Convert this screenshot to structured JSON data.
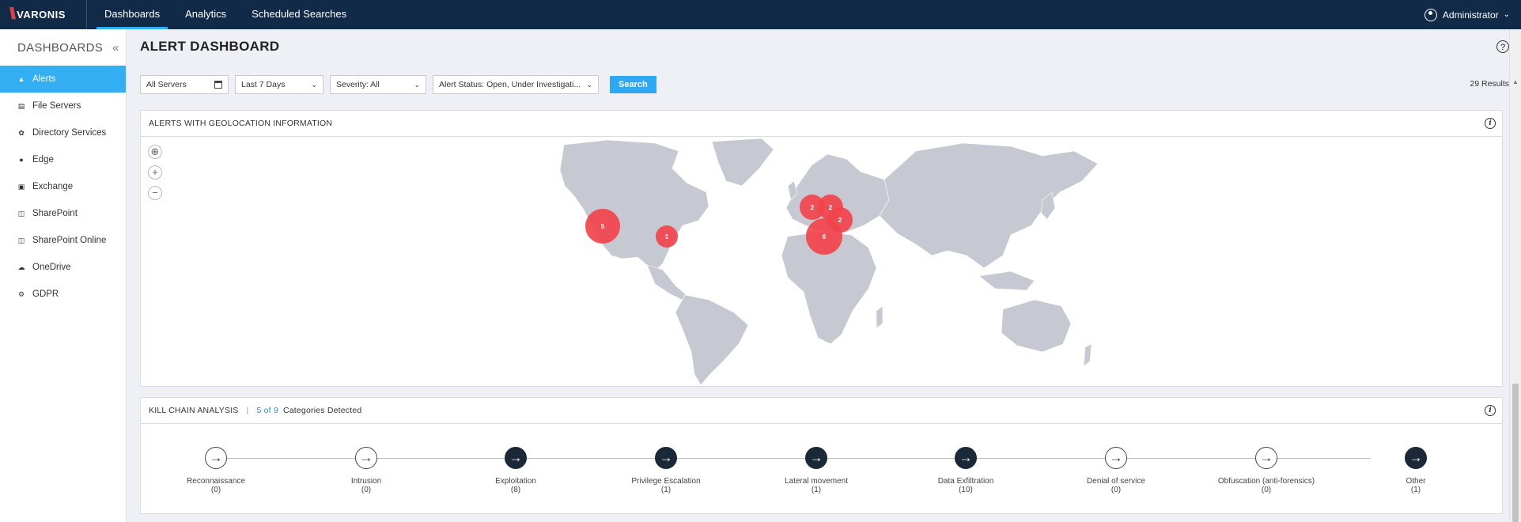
{
  "brand": {
    "name": "VARONIS"
  },
  "nav": {
    "items": [
      "Dashboards",
      "Analytics",
      "Scheduled Searches"
    ],
    "active": "Dashboards"
  },
  "user": {
    "name": "Administrator"
  },
  "sidebar": {
    "title": "DASHBOARDS",
    "items": [
      {
        "label": "Alerts",
        "icon": "bell-icon",
        "active": true
      },
      {
        "label": "File Servers",
        "icon": "database-icon",
        "active": false
      },
      {
        "label": "Directory Services",
        "icon": "network-icon",
        "active": false
      },
      {
        "label": "Edge",
        "icon": "shield-icon",
        "active": false
      },
      {
        "label": "Exchange",
        "icon": "exchange-icon",
        "active": false
      },
      {
        "label": "SharePoint",
        "icon": "sharepoint-icon",
        "active": false
      },
      {
        "label": "SharePoint Online",
        "icon": "sharepoint-online-icon",
        "active": false
      },
      {
        "label": "OneDrive",
        "icon": "cloud-icon",
        "active": false
      },
      {
        "label": "GDPR",
        "icon": "gear-icon",
        "active": false
      }
    ]
  },
  "page": {
    "title": "ALERT DASHBOARD"
  },
  "filters": {
    "servers": "All Servers",
    "date_range": "Last 7 Days",
    "severity": "Severity:  All",
    "alert_status": "Alert Status:  Open, Under Investigati...",
    "search_label": "Search",
    "results": "29 Results"
  },
  "map_panel": {
    "title": "ALERTS WITH GEOLOCATION INFORMATION",
    "markers": [
      {
        "region": "Western North America",
        "count": "5"
      },
      {
        "region": "Eastern North America",
        "count": "1"
      },
      {
        "region": "Northern Europe West",
        "count": "2"
      },
      {
        "region": "Northern Europe East",
        "count": "2"
      },
      {
        "region": "Central Europe",
        "count": "2"
      },
      {
        "region": "Southern Europe",
        "count": "6"
      }
    ],
    "colors": {
      "marker": "#f2434b",
      "land": "#c6c9d1"
    }
  },
  "kill_chain": {
    "title": "KILL CHAIN ANALYSIS",
    "detected_count": "5 of 9",
    "detected_label": "Categories Detected",
    "stages": [
      {
        "label": "Reconnaissance",
        "count": "(0)",
        "detected": false
      },
      {
        "label": "Intrusion",
        "count": "(0)",
        "detected": false
      },
      {
        "label": "Exploitation",
        "count": "(8)",
        "detected": true
      },
      {
        "label": "Privilege Escalation",
        "count": "(1)",
        "detected": true
      },
      {
        "label": "Lateral movement",
        "count": "(1)",
        "detected": true
      },
      {
        "label": "Data Exfiltration",
        "count": "(10)",
        "detected": true
      },
      {
        "label": "Denial of service",
        "count": "(0)",
        "detected": false
      },
      {
        "label": "Obfuscation (anti-forensics)",
        "count": "(0)",
        "detected": false
      },
      {
        "label": "Other",
        "count": "(1)",
        "detected": true
      }
    ]
  }
}
